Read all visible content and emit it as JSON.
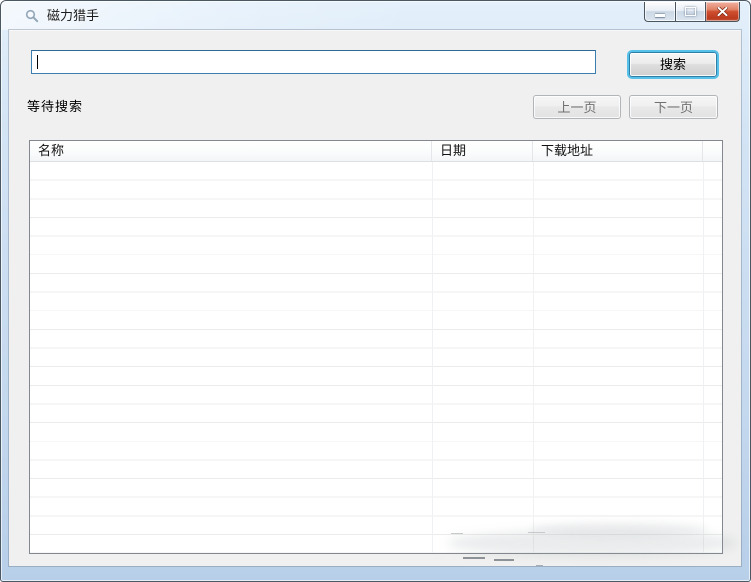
{
  "window": {
    "title": "磁力猎手"
  },
  "toolbar": {
    "search_value": "",
    "search_placeholder": "",
    "search_button_label": "搜索"
  },
  "status": {
    "text": "等待搜索"
  },
  "pagination": {
    "prev_label": "上一页",
    "next_label": "下一页",
    "state": "disabled"
  },
  "table": {
    "columns": [
      {
        "label": "名称"
      },
      {
        "label": "日期"
      },
      {
        "label": "下载地址"
      },
      {
        "label": ""
      }
    ],
    "rows": []
  },
  "icons": {
    "app": "search-icon",
    "minimize": "minimize-icon",
    "maximize": "maximize-icon",
    "close": "close-icon"
  },
  "colors": {
    "frame_blue": "#c4d8ee",
    "client_bg": "#f0f0f0",
    "close_button_red": "#cf4f30",
    "focus_ring_cyan": "#55c0e8",
    "input_border_blue": "#3c7fb1",
    "table_border": "#828790"
  }
}
